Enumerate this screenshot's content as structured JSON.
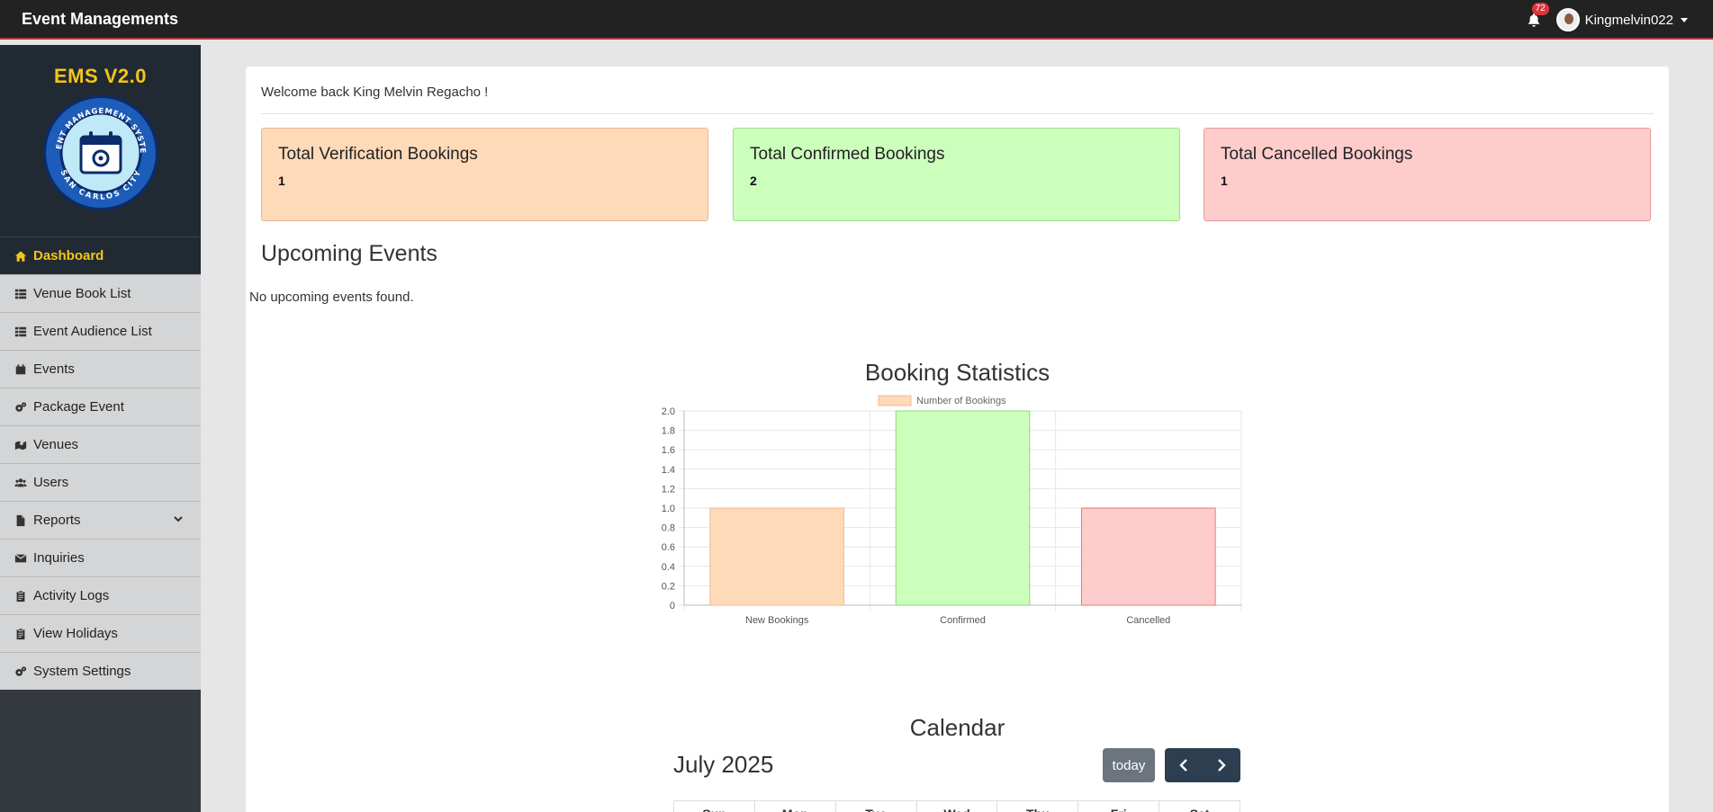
{
  "topbar": {
    "brand": "Event Managements",
    "notification_count": "72",
    "username": "Kingmelvin022"
  },
  "sidebar": {
    "title": "EMS V2.0",
    "logo": {
      "top_text": "EVENT MANAGEMENT SYSTEM",
      "bottom_text": "SAN CARLOS CITY"
    },
    "items": [
      {
        "label": "Dashboard",
        "icon": "home-icon",
        "active": true
      },
      {
        "label": "Venue Book List",
        "icon": "list-icon"
      },
      {
        "label": "Event Audience List",
        "icon": "list-icon"
      },
      {
        "label": "Events",
        "icon": "calendar-icon"
      },
      {
        "label": "Package Event",
        "icon": "cogs-icon"
      },
      {
        "label": "Venues",
        "icon": "map-marker-icon"
      },
      {
        "label": "Users",
        "icon": "users-icon"
      },
      {
        "label": "Reports",
        "icon": "file-icon"
      },
      {
        "label": "Inquiries",
        "icon": "envelope-icon"
      },
      {
        "label": "Activity Logs",
        "icon": "clipboard-icon"
      },
      {
        "label": "View Holidays",
        "icon": "clipboard-icon"
      },
      {
        "label": "System Settings",
        "icon": "cogs-icon"
      }
    ]
  },
  "main": {
    "welcome": "Welcome back King Melvin Regacho !",
    "stats": [
      {
        "label": "Total Verification Bookings",
        "value": "1"
      },
      {
        "label": "Total Confirmed Bookings",
        "value": "2"
      },
      {
        "label": "Total Cancelled Bookings",
        "value": "1"
      }
    ],
    "upcoming_title": "Upcoming Events",
    "upcoming_empty": "No upcoming events found.",
    "chart_heading": "Booking Statistics",
    "calendar": {
      "title": "Calendar",
      "month": "July 2025",
      "today_label": "today",
      "weekdays": [
        "Sun",
        "Mon",
        "Tue",
        "Wed",
        "Thu",
        "Fri",
        "Sat"
      ]
    }
  },
  "chart_data": {
    "type": "bar",
    "title": "Booking Statistics",
    "categories": [
      "New Bookings",
      "Confirmed",
      "Cancelled"
    ],
    "series": [
      {
        "name": "Number of Bookings",
        "values": [
          1,
          2,
          1
        ]
      }
    ],
    "ylim": [
      0,
      2.0
    ],
    "yticks": [
      "0",
      "0.2",
      "0.4",
      "0.6",
      "0.8",
      "1.0",
      "1.2",
      "1.4",
      "1.6",
      "1.8",
      "2.0"
    ],
    "bar_colors": [
      "#ffdab9",
      "#ccffbc",
      "#ffcccc"
    ],
    "bar_borders": [
      "#f0b88f",
      "#8fd97a",
      "#e07a7a"
    ],
    "grid": true,
    "legend": "top-center"
  },
  "colors": {
    "accent": "#f5c518",
    "sidebar_dark": "#212a33",
    "nav_btn": "#2c3e50",
    "today_btn": "#6c757d"
  }
}
